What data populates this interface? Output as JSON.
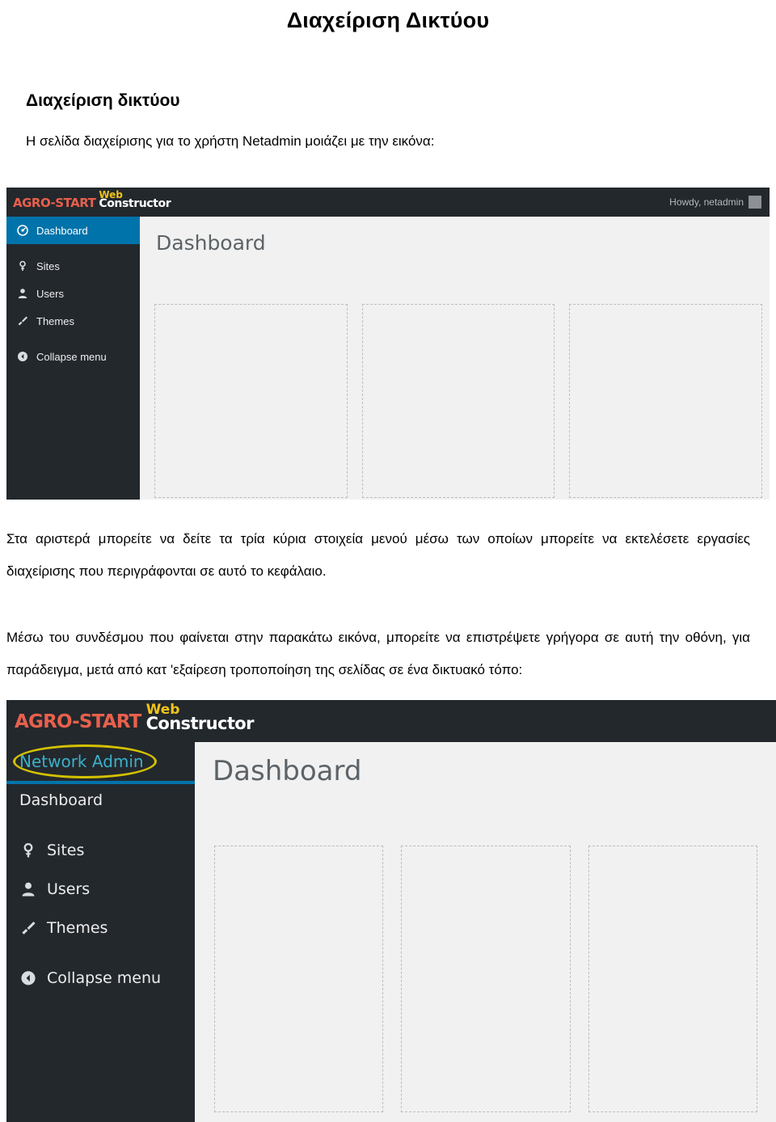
{
  "document": {
    "title": "Διαχείριση Δικτύου",
    "section_title": "Διαχείριση δικτύου",
    "intro": "Η σελίδα διαχείρισης για το χρήστη Netadmin μοιάζει με την εικόνα:",
    "paragraph_1": "Στα αριστερά μπορείτε να δείτε τα τρία κύρια στοιχεία μενού μέσω των οποίων μπορείτε να εκτελέσετε εργασίες διαχείρισης που περιγράφονται σε αυτό το κεφάλαιο.",
    "paragraph_2": "Μέσω του συνδέσμου που φαίνεται στην παρακάτω εικόνα, μπορείτε να επιστρέψετε γρήγορα σε αυτή την οθόνη, για παράδειγμα, μετά από κατ 'εξαίρεση τροποποίηση της σελίδας σε ένα δικτυακό τόπο:"
  },
  "screenshot1": {
    "logo": {
      "agro": "AGRO-START",
      "web": "Web",
      "constructor": "Constructor"
    },
    "account": {
      "greeting": "Howdy, netadmin",
      "avatar_icon": "user-avatar-icon"
    },
    "menu": [
      {
        "label": "Dashboard",
        "icon": "dashboard-icon",
        "icon_glyph": "◉",
        "current": true
      },
      {
        "label": "Sites",
        "icon": "pin-icon",
        "icon_glyph": "⚲"
      },
      {
        "label": "Users",
        "icon": "users-icon",
        "icon_glyph": "👤"
      },
      {
        "label": "Themes",
        "icon": "brush-icon",
        "icon_glyph": "✎"
      },
      {
        "label": "Collapse menu",
        "icon": "collapse-left-icon",
        "icon_glyph": "◀"
      }
    ],
    "page_heading": "Dashboard",
    "panel_count": 3
  },
  "screenshot2": {
    "logo": {
      "agro": "AGRO-START",
      "web": "Web",
      "constructor": "Constructor"
    },
    "network_admin_link": "Network Admin",
    "highlight_color": "#d4c100",
    "menu": [
      {
        "label": "Dashboard",
        "icon": "dashboard-icon",
        "icon_glyph": ""
      },
      {
        "label": "Sites",
        "icon": "pin-icon",
        "icon_glyph": "⚲"
      },
      {
        "label": "Users",
        "icon": "users-icon",
        "icon_glyph": "👤"
      },
      {
        "label": "Themes",
        "icon": "brush-icon",
        "icon_glyph": "✎"
      },
      {
        "label": "Collapse menu",
        "icon": "collapse-left-icon",
        "icon_glyph": "◀"
      }
    ],
    "page_heading": "Dashboard",
    "panel_count": 3
  }
}
